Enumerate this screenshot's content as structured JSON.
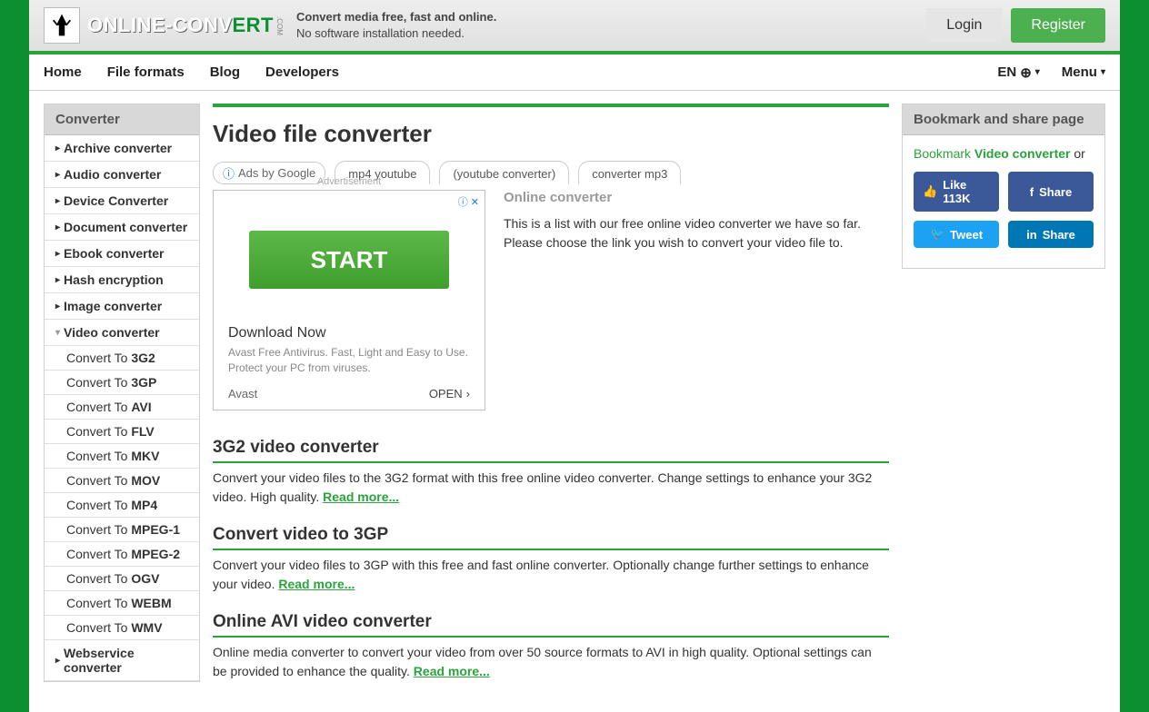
{
  "header": {
    "logo_part1": "ONLINE-CONV",
    "logo_part2": "ERT",
    "logo_sub": ".COM",
    "tagline_bold": "Convert media free, fast and online.",
    "tagline_sub": "No software installation needed.",
    "login": "Login",
    "register": "Register"
  },
  "nav": {
    "items": [
      "Home",
      "File formats",
      "Blog",
      "Developers"
    ],
    "lang": "EN",
    "menu": "Menu"
  },
  "sidebar": {
    "header": "Converter",
    "categories": [
      "Archive converter",
      "Audio converter",
      "Device Converter",
      "Document converter",
      "Ebook converter",
      "Hash encryption",
      "Image converter",
      "Video converter",
      "Webservice converter"
    ],
    "sub_prefix": "Convert To ",
    "video_formats": [
      "3G2",
      "3GP",
      "AVI",
      "FLV",
      "MKV",
      "MOV",
      "MP4",
      "MPEG-1",
      "MPEG-2",
      "OGV",
      "WEBM",
      "WMV"
    ]
  },
  "main": {
    "title": "Video file converter",
    "ads_by": "Ads by Google",
    "ad_links": [
      "mp4 youtube",
      "(youtube converter)",
      "converter mp3"
    ],
    "ad_label": "Advertisement",
    "ad_corner": "ⓘ ✕",
    "start": "START",
    "dl_now": "Download Now",
    "dl_desc": "Avast Free Antivirus. Fast, Light and Easy to Use. Protect your PC from viruses.",
    "dl_brand": "Avast",
    "dl_open": "OPEN",
    "intro_title": "Online converter",
    "intro_text": "This is a list with our free online video converter we have so far. Please choose the link you wish to convert your video file to.",
    "read_more": "Read more...",
    "converters": [
      {
        "title": "3G2 video converter",
        "desc": "Convert your video files to the 3G2 format with this free online video converter. Change settings to enhance your 3G2 video. High quality. "
      },
      {
        "title": "Convert video to 3GP",
        "desc": "Convert your video files to 3GP with this free and fast online converter. Optionally change further settings to enhance your video. "
      },
      {
        "title": "Online AVI video converter",
        "desc": "Online media converter to convert your video from over 50 source formats to AVI in high quality. Optional settings can be provided to enhance the quality. "
      }
    ]
  },
  "rightbar": {
    "header": "Bookmark and share page",
    "bookmark_pre": "Bookmark ",
    "bookmark_bold": "Video converter",
    "bookmark_post": " or",
    "like": "Like 113K",
    "share": "Share",
    "tweet": "Tweet",
    "li_share": "Share"
  }
}
